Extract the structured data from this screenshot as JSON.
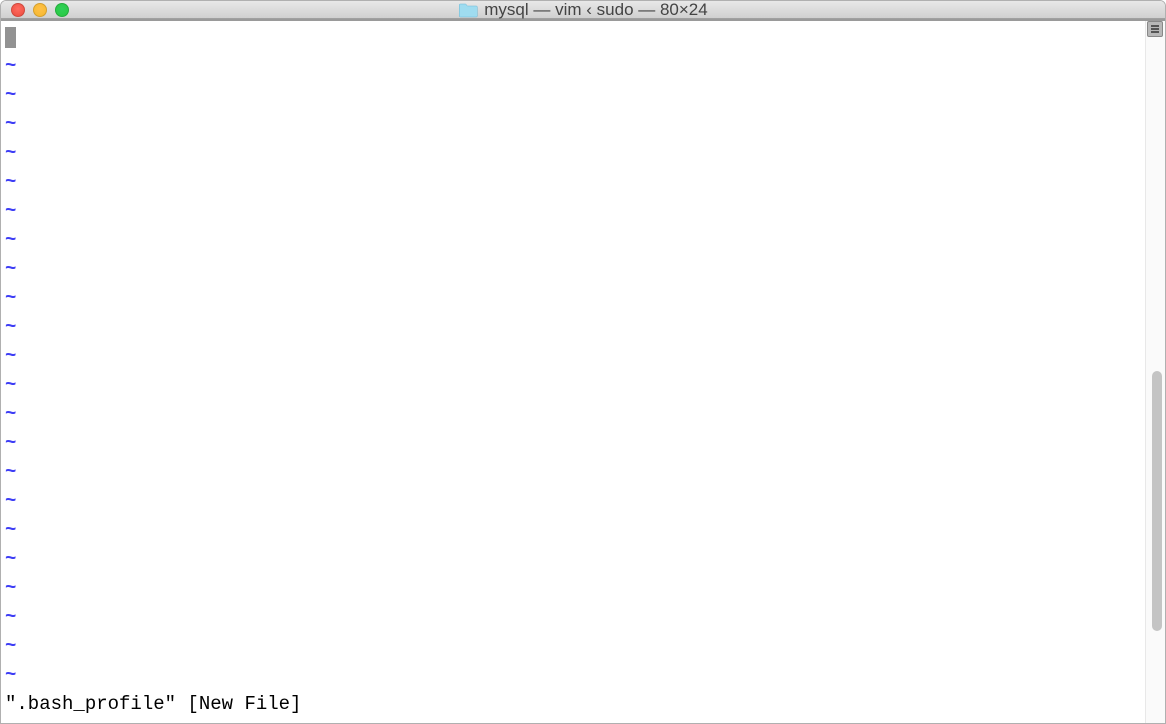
{
  "window": {
    "title": "mysql — vim ‹ sudo — 80×24",
    "folderIconName": "folder-icon"
  },
  "editor": {
    "tildeChar": "~",
    "emptyLineCount": 22
  },
  "statusLine": "\".bash_profile\" [New File]"
}
